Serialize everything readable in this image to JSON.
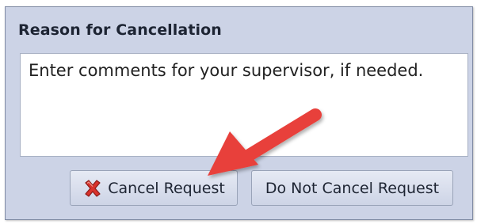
{
  "panel": {
    "title": "Reason for Cancellation",
    "comments_placeholder": "Enter comments for your supervisor, if needed.",
    "comments_value": ""
  },
  "buttons": {
    "cancel_label": "Cancel Request",
    "cancel_icon": "red-x-icon",
    "keep_label": "Do Not Cancel Request"
  },
  "annotation": {
    "arrow_color": "#e8403a",
    "points_to": "cancel-request-button"
  },
  "colors": {
    "panel_bg": "#ccd3e6",
    "button_bg": "#dde2ee",
    "cancel_icon": "#d8322c"
  }
}
